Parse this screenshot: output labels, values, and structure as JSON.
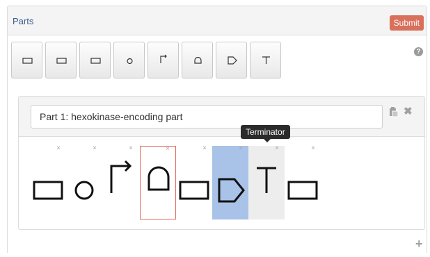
{
  "panel": {
    "title": "Parts",
    "submit_label": "Submit"
  },
  "palette": {
    "buttons": [
      {
        "icon": "cds-icon"
      },
      {
        "icon": "cds-icon"
      },
      {
        "icon": "cds-icon"
      },
      {
        "icon": "rbs-icon"
      },
      {
        "icon": "promoter-icon"
      },
      {
        "icon": "insulator-icon"
      },
      {
        "icon": "cds-arrow-icon"
      },
      {
        "icon": "terminator-icon"
      }
    ],
    "help_glyph": "?"
  },
  "part": {
    "name_value": "Part 1: hexokinase-encoding part",
    "slots": [
      {
        "icon": "cds-icon",
        "remove": "×"
      },
      {
        "icon": "rbs-icon",
        "remove": "×"
      },
      {
        "icon": "promoter-icon",
        "remove": "×"
      },
      {
        "icon": "insulator-icon",
        "remove": "×",
        "state": "selected"
      },
      {
        "icon": "cds-icon",
        "remove": "×"
      },
      {
        "icon": "cds-arrow-icon",
        "remove": "×",
        "state": "highlight"
      },
      {
        "icon": "terminator-icon",
        "remove": "×",
        "state": "hover"
      },
      {
        "icon": "cds-icon",
        "remove": "×"
      }
    ],
    "close_glyph": "✖"
  },
  "tooltip": {
    "text": "Terminator"
  },
  "add_glyph": "+",
  "colors": {
    "submit": "#d9705c",
    "selected_border": "#e06b5a",
    "highlight": "#a9c2e8"
  }
}
